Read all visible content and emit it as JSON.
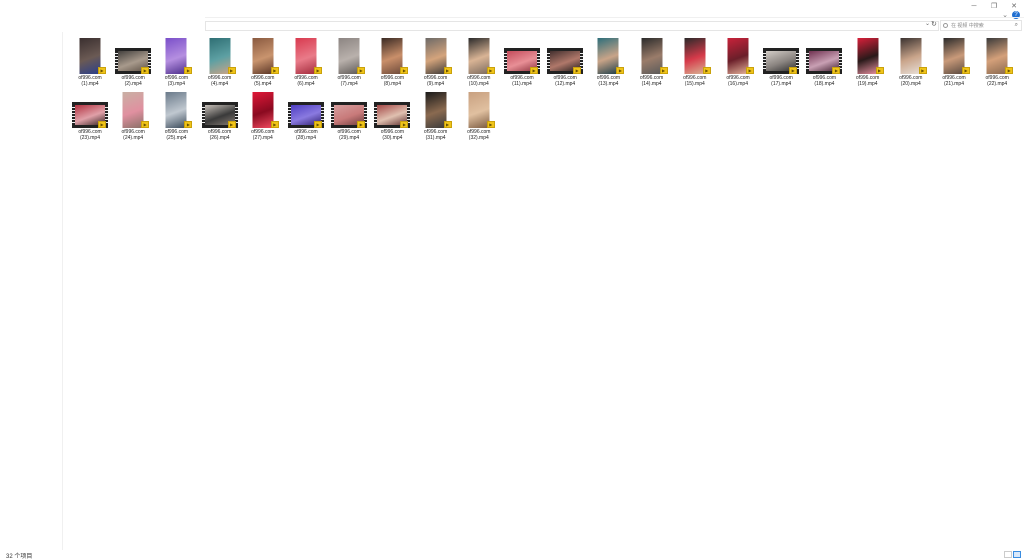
{
  "window": {
    "controls": {
      "minimize": "─",
      "maximize": "❐",
      "close": "✕"
    },
    "help": "?",
    "ribbon_chevron": "⌄"
  },
  "address_bar": {
    "dropdown": "⌄",
    "refresh": "↻"
  },
  "search": {
    "placeholder": "在 视频 中搜索",
    "go": "⌕"
  },
  "files": [
    {
      "line1": "of996.com",
      "line2": "(1).mp4",
      "orientation": "portrait",
      "colors": [
        "#3a2f2f",
        "#6b5a54",
        "#2b3f8c"
      ]
    },
    {
      "line1": "of996.com",
      "line2": "(2).mp4",
      "orientation": "landscape",
      "colors": [
        "#3c3a38",
        "#a89a8c",
        "#5a4d42"
      ]
    },
    {
      "line1": "of996.com",
      "line2": "(3).mp4",
      "orientation": "portrait",
      "colors": [
        "#7a4fc9",
        "#b58fe0",
        "#4b2d8a"
      ]
    },
    {
      "line1": "of996.com",
      "line2": "(4).mp4",
      "orientation": "portrait",
      "colors": [
        "#2f6f74",
        "#5da0a3",
        "#c9a488"
      ]
    },
    {
      "line1": "of996.com",
      "line2": "(5).mp4",
      "orientation": "portrait",
      "colors": [
        "#8a5a40",
        "#c9946e",
        "#5a3526"
      ]
    },
    {
      "line1": "of996.com",
      "line2": "(6).mp4",
      "orientation": "portrait",
      "colors": [
        "#d83a4f",
        "#e97b89",
        "#a22a3b"
      ]
    },
    {
      "line1": "of996.com",
      "line2": "(7).mp4",
      "orientation": "portrait",
      "colors": [
        "#8c8582",
        "#b9b1ac",
        "#5f5a57"
      ]
    },
    {
      "line1": "of996.com",
      "line2": "(8).mp4",
      "orientation": "portrait",
      "colors": [
        "#3a2a24",
        "#c98f6a",
        "#6d4a3a"
      ]
    },
    {
      "line1": "of996.com",
      "line2": "(9).mp4",
      "orientation": "portrait",
      "colors": [
        "#6d6a67",
        "#d4a47c",
        "#3e3b39"
      ]
    },
    {
      "line1": "of996.com",
      "line2": "(10).mp4",
      "orientation": "portrait",
      "colors": [
        "#2a2a2a",
        "#d9b495",
        "#7a6a5e"
      ]
    },
    {
      "line1": "of996.com",
      "line2": "(11).mp4",
      "orientation": "landscape",
      "colors": [
        "#c24858",
        "#e88f96",
        "#8a2f3b"
      ]
    },
    {
      "line1": "of996.com",
      "line2": "(12).mp4",
      "orientation": "landscape",
      "colors": [
        "#3b2b2b",
        "#b0786a",
        "#1e1a1a"
      ]
    },
    {
      "line1": "of996.com",
      "line2": "(13).mp4",
      "orientation": "portrait",
      "colors": [
        "#2d6e7a",
        "#c9a488",
        "#1f3f4a"
      ]
    },
    {
      "line1": "of996.com",
      "line2": "(14).mp4",
      "orientation": "portrait",
      "colors": [
        "#2b2b2b",
        "#9a7c6a",
        "#5a5a5a"
      ]
    },
    {
      "line1": "of996.com",
      "line2": "(15).mp4",
      "orientation": "portrait",
      "colors": [
        "#2a2a2a",
        "#d63a4a",
        "#d9b495"
      ]
    },
    {
      "line1": "of996.com",
      "line2": "(16).mp4",
      "orientation": "portrait",
      "colors": [
        "#c8223a",
        "#6b1f2a",
        "#e4b29a"
      ]
    },
    {
      "line1": "of996.com",
      "line2": "(17).mp4",
      "orientation": "landscape",
      "colors": [
        "#d8d2cc",
        "#8a8480",
        "#2a2a2a"
      ]
    },
    {
      "line1": "of996.com",
      "line2": "(18).mp4",
      "orientation": "landscape",
      "colors": [
        "#6a2a4a",
        "#c9a0b4",
        "#3a1a2a"
      ]
    },
    {
      "line1": "of996.com",
      "line2": "(19).mp4",
      "orientation": "portrait",
      "colors": [
        "#d8203a",
        "#2a1a1a",
        "#e890a0"
      ]
    },
    {
      "line1": "of996.com",
      "line2": "(20).mp4",
      "orientation": "portrait",
      "colors": [
        "#3a3230",
        "#c9a48a",
        "#e8e0d8"
      ]
    },
    {
      "line1": "of996.com",
      "line2": "(21).mp4",
      "orientation": "portrait",
      "colors": [
        "#2a2a2a",
        "#c99a7a",
        "#5a4a40"
      ]
    },
    {
      "line1": "of996.com",
      "line2": "(22).mp4",
      "orientation": "portrait",
      "colors": [
        "#3a3a3a",
        "#d4a07a",
        "#8a6a50"
      ]
    },
    {
      "line1": "of996.com",
      "line2": "(23).mp4",
      "orientation": "landscape",
      "colors": [
        "#b02a3a",
        "#e0a0a8",
        "#2a1a1a"
      ]
    },
    {
      "line1": "of996.com",
      "line2": "(24).mp4",
      "orientation": "portrait",
      "colors": [
        "#c9b0a4",
        "#e090a0",
        "#8a7068"
      ]
    },
    {
      "line1": "of996.com",
      "line2": "(25).mp4",
      "orientation": "portrait",
      "colors": [
        "#6a7a8a",
        "#c0c8d0",
        "#3a4a5a"
      ]
    },
    {
      "line1": "of996.com",
      "line2": "(26).mp4",
      "orientation": "landscape",
      "colors": [
        "#d0c8c0",
        "#3a3a3a",
        "#8a8078"
      ]
    },
    {
      "line1": "of996.com",
      "line2": "(27).mp4",
      "orientation": "portrait",
      "colors": [
        "#e01838",
        "#8a0a20",
        "#f04a60"
      ]
    },
    {
      "line1": "of996.com",
      "line2": "(28).mp4",
      "orientation": "landscape",
      "colors": [
        "#4a3ac0",
        "#8a7ae0",
        "#2a1a6a"
      ]
    },
    {
      "line1": "of996.com",
      "line2": "(29).mp4",
      "orientation": "landscape",
      "colors": [
        "#d8a0a0",
        "#c87a7a",
        "#6a3a3a"
      ]
    },
    {
      "line1": "of996.com",
      "line2": "(30).mp4",
      "orientation": "landscape",
      "colors": [
        "#a04040",
        "#e0c0b0",
        "#5a2a2a"
      ]
    },
    {
      "line1": "of996.com",
      "line2": "(31).mp4",
      "orientation": "portrait",
      "colors": [
        "#1a1a1a",
        "#8a6a50",
        "#3a3a3a"
      ]
    },
    {
      "line1": "of996.com",
      "line2": "(32).mp4",
      "orientation": "portrait",
      "colors": [
        "#c8a080",
        "#e0c0a0",
        "#7a5a40"
      ]
    }
  ],
  "badge_icon": "play-badge-icon",
  "status": {
    "item_count": "32 个项目"
  }
}
